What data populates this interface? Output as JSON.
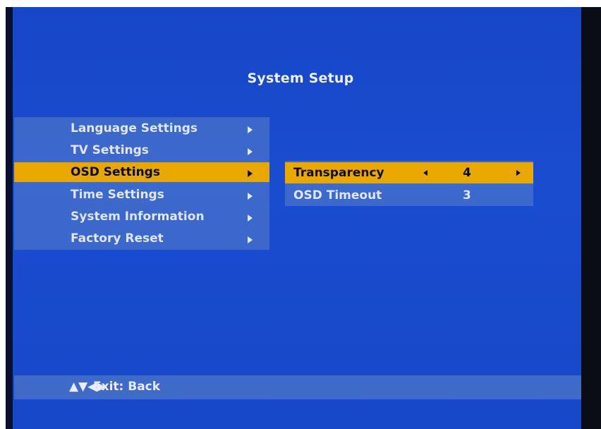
{
  "title": "System Setup",
  "menu": {
    "items": [
      {
        "label": "Language Settings",
        "selected": false
      },
      {
        "label": "TV Settings",
        "selected": false
      },
      {
        "label": "OSD Settings",
        "selected": true
      },
      {
        "label": "Time Settings",
        "selected": false
      },
      {
        "label": "System Information",
        "selected": false
      },
      {
        "label": "Factory Reset",
        "selected": false
      }
    ]
  },
  "submenu": {
    "rows": [
      {
        "label": "Transparency",
        "value": "4",
        "selected": true
      },
      {
        "label": "OSD Timeout",
        "value": "3",
        "selected": false
      }
    ]
  },
  "footer": {
    "nav_icons": "▲▼◀▶",
    "hint": "Exit: Back"
  },
  "colors": {
    "background": "#1a4cd0",
    "highlight": "#e8a800",
    "panel": "#5a82c8"
  }
}
